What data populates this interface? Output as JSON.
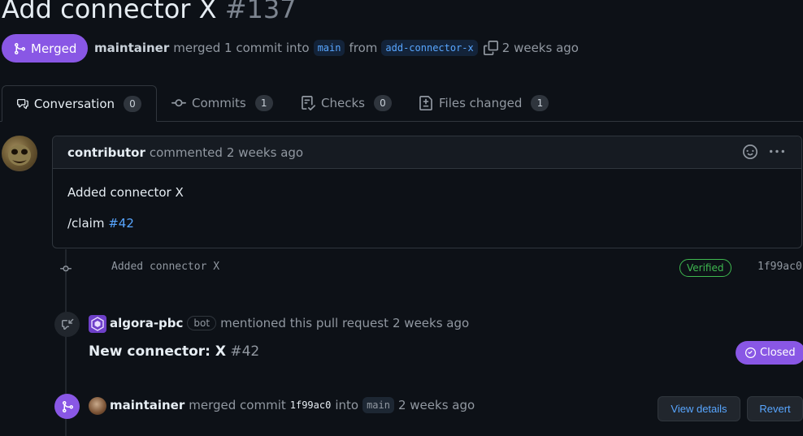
{
  "pr": {
    "title": "Add connector X",
    "number": "#137",
    "status": "Merged",
    "author": "maintainer",
    "merge_text": "merged 1 commit into",
    "base_branch": "main",
    "from_text": "from",
    "head_branch": "add-connector-x",
    "time": "2 weeks ago"
  },
  "tabs": [
    {
      "label": "Conversation",
      "count": "0",
      "icon": "comment-discussion-icon"
    },
    {
      "label": "Commits",
      "count": "1",
      "icon": "git-commit-icon"
    },
    {
      "label": "Checks",
      "count": "0",
      "icon": "checklist-icon"
    },
    {
      "label": "Files changed",
      "count": "1",
      "icon": "file-diff-icon"
    }
  ],
  "comment": {
    "author": "contributor",
    "action": "commented",
    "time": "2 weeks ago",
    "body_line1": "Added connector X",
    "body_claim": "/claim",
    "body_issue": "#42"
  },
  "commit": {
    "message": "Added connector X",
    "verified": "Verified",
    "sha": "1f99ac0"
  },
  "mention": {
    "actor": "algora-pbc",
    "bot_label": "bot",
    "action": "mentioned this pull request",
    "time": "2 weeks ago",
    "ref_title": "New connector: X",
    "ref_number": "#42",
    "ref_status": "Closed"
  },
  "merge_event": {
    "actor": "maintainer",
    "action": "merged commit",
    "sha": "1f99ac0",
    "into": "into",
    "branch": "main",
    "time": "2 weeks ago",
    "view_details": "View details",
    "revert": "Revert"
  },
  "colors": {
    "merged_purple": "#8957e5",
    "link_blue": "#58a6ff",
    "verified_green": "#3fb950",
    "background": "#0d1117"
  }
}
